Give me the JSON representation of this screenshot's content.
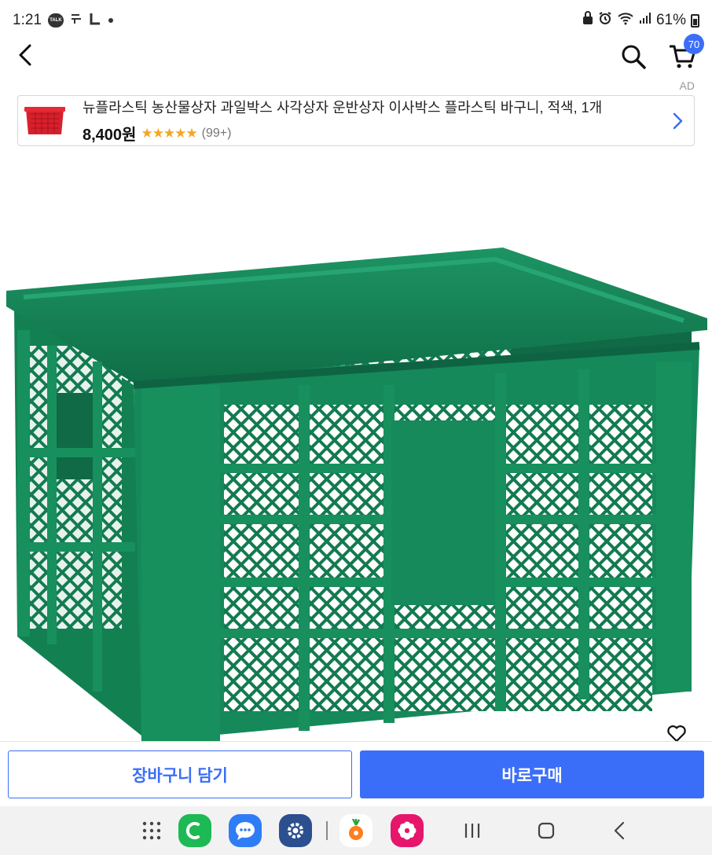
{
  "status_bar": {
    "time": "1:21",
    "talk_badge": "TALK",
    "battery": "61%"
  },
  "app_bar": {
    "cart_count": "70"
  },
  "ad": {
    "label": "AD",
    "title": "뉴플라스틱 농산물상자 과일박스 사각상자 운반상자 이사박스 플라스틱 바구니, 적색, 1개",
    "price": "8,400원",
    "rating": 5,
    "stars": "★★★★★",
    "reviews": "(99+)"
  },
  "actions": {
    "add_to_cart": "장바구니 담기",
    "buy_now": "바로구매"
  },
  "colors": {
    "accent": "#3b6ef8",
    "star": "#f5a623",
    "crate_green": "#17855a",
    "ad_thumb_red": "#d8202c"
  },
  "icons": {
    "back": "chevron-left-icon",
    "search": "search-icon",
    "cart": "cart-icon",
    "wish": "heart-icon",
    "ad_arrow": "chevron-right-icon"
  }
}
